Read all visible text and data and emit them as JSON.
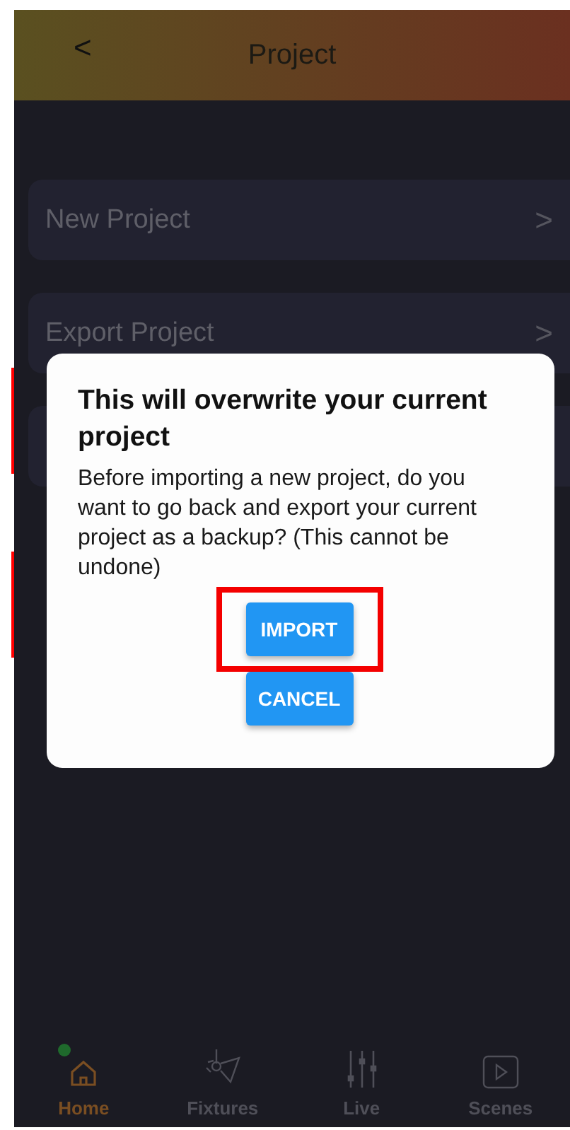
{
  "header": {
    "back": "<",
    "title": "Project"
  },
  "menu": [
    {
      "label": "New Project",
      "chevron": ">"
    },
    {
      "label": "Export Project",
      "chevron": ">"
    }
  ],
  "dialog": {
    "title": "This will overwrite your current project",
    "message": "Before importing a new project, do you want to go back and export your current project as a backup? (This cannot be undone)",
    "buttons": [
      {
        "label": "IMPORT",
        "highlighted": true
      },
      {
        "label": "CANCEL",
        "highlighted": false
      }
    ]
  },
  "nav": [
    {
      "label": "Home",
      "selected": true,
      "notification_dot": true
    },
    {
      "label": "Fixtures",
      "selected": false,
      "notification_dot": false
    },
    {
      "label": "Live",
      "selected": false,
      "notification_dot": false
    },
    {
      "label": "Scenes",
      "selected": false,
      "notification_dot": false
    }
  ]
}
